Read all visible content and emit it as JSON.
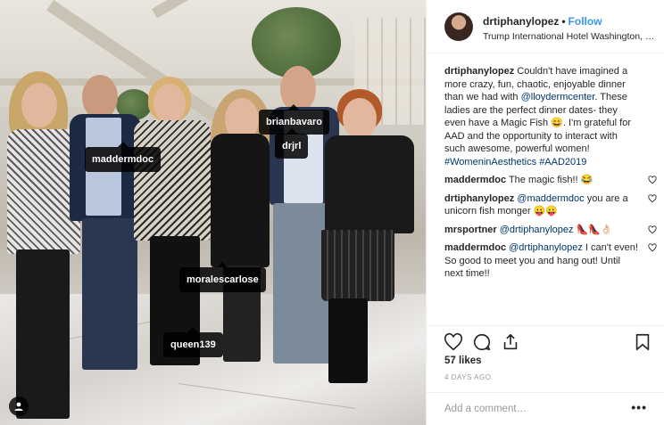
{
  "header": {
    "username": "drtiphanylopez",
    "separator": "•",
    "follow_label": "Follow",
    "location": "Trump International Hotel Washington, D.C."
  },
  "photo": {
    "tags": [
      {
        "label": "maddermdoc"
      },
      {
        "label": "brianbavaro"
      },
      {
        "label": "drjrl"
      },
      {
        "label": "moralescarlose"
      },
      {
        "label": "queen139"
      }
    ]
  },
  "caption": {
    "user": "drtiphanylopez",
    "text_1": "Couldn't have imagined a more crazy, fun, chaotic, enjoyable dinner than we had with ",
    "mention": "@lloydermcenter",
    "text_2": ". These ladies are the perfect dinner dates- they even have a Magic Fish 😄. I'm grateful for AAD and the opportunity to interact with such awesome, powerful women! ",
    "hashtag_1": "#WomeninAesthetics",
    "space": " ",
    "hashtag_2": "#AAD2019"
  },
  "comments": [
    {
      "user": "maddermdoc",
      "text": "The magic fish!! 😂"
    },
    {
      "user": "drtiphanylopez",
      "mention": "@maddermdoc",
      "text": " you are a unicorn fish monger 😛😛"
    },
    {
      "user": "mrsportner",
      "mention": "@drtiphanylopez",
      "text": " 👠👠👌🏻"
    },
    {
      "user": "maddermdoc",
      "mention": "@drtiphanylopez",
      "text": " I can't even! So good to meet you and hang out! Until next time!!"
    }
  ],
  "stats": {
    "likes": "57 likes",
    "date": "4 DAYS AGO"
  },
  "add_comment": {
    "placeholder": "Add a comment…",
    "more": "•••"
  },
  "icons": [
    "heart-icon",
    "comment-icon",
    "share-icon",
    "bookmark-icon",
    "user-tags-icon"
  ],
  "colors": {
    "link": "#003569",
    "follow": "#3897f0",
    "muted": "#999999",
    "text": "#262626"
  }
}
